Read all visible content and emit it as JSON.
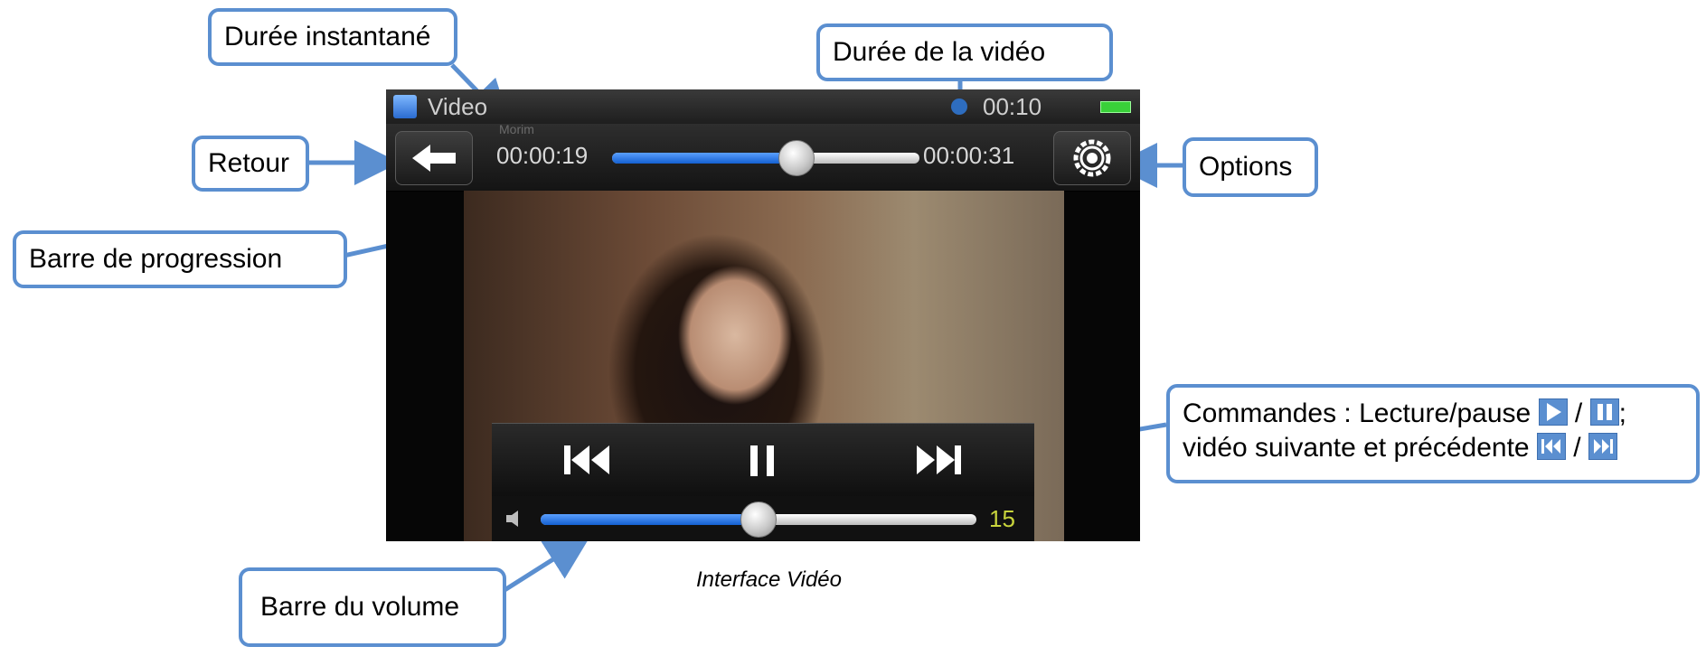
{
  "screen": {
    "status": {
      "app_title": "Video",
      "clock": "00:10"
    },
    "topbar": {
      "subtitle": "Morim",
      "current_time": "00:00:19",
      "total_time": "00:00:31",
      "progress": 0.6
    },
    "volume": {
      "level": "15",
      "fraction": 0.5
    },
    "icons": {
      "back": "back-arrow-icon",
      "options": "gear-icon",
      "previous": "skip-previous-icon",
      "pause": "pause-icon",
      "next": "skip-next-icon",
      "speaker": "speaker-icon",
      "battery": "battery-icon",
      "app": "video-clapper-icon"
    }
  },
  "annotations": {
    "duree_instantane": "Durée instantané",
    "duree_video": "Durée de la vidéo",
    "retour": "Retour",
    "options": "Options",
    "barre_progression": "Barre de progression",
    "commandes_line1": "Commandes : Lecture/pause",
    "commandes_line1_sep": "/",
    "commandes_line1_end": ";",
    "commandes_line2": "vidéo suivante et précédente",
    "commandes_line2_sep": "/",
    "barre_volume": "Barre du volume"
  },
  "caption": "Interface Vidéo",
  "colors": {
    "callout_border": "#5b8fd0",
    "progress_fill": "#1460d0",
    "volume_number": "#c8d43c",
    "battery": "#39d039"
  }
}
